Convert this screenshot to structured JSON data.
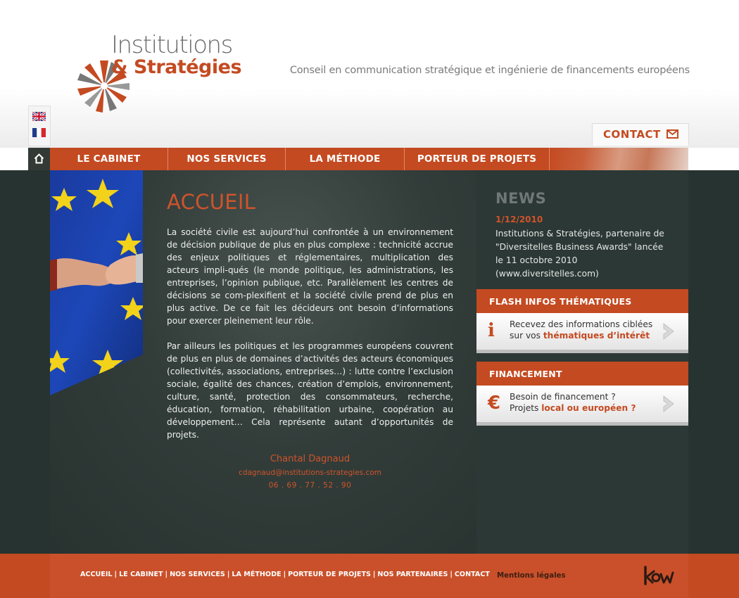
{
  "brand": {
    "line1": "Institutions",
    "line2": "& Stratégies",
    "tagline": "Conseil en communication stratégique et ingénierie de financements européens",
    "accent": "#c44a21",
    "dark": "#263330"
  },
  "languages": [
    "uk-flag-icon",
    "fr-flag-icon"
  ],
  "contact": {
    "label": "CONTACT",
    "icon": "envelope-icon"
  },
  "nav": {
    "home_icon": "home-icon",
    "items": [
      "LE CABINET",
      "NOS SERVICES",
      "LA MÉTHODE",
      "PORTEUR DE PROJETS"
    ]
  },
  "main": {
    "title": "ACCUEIL",
    "paragraphs": [
      "La société civile est aujourd’hui confrontée à un environnement de décision publique de plus en plus complexe : technicité accrue des enjeux politiques et réglementaires, multiplication des acteurs impli-qués (le monde politique, les administrations, les entreprises, l’opinion publique, etc. Parallèlement les centres de décisions se com-plexifient et la société civile prend de plus en plus active. De ce fait les décideurs ont besoin d’informations pour exercer pleinement leur rôle.",
      "Par ailleurs les politiques et les programmes européens couvrent de plus en plus de domaines d’activités des acteurs économiques (collectivités, associations, entreprises…) : lutte contre l’exclusion sociale, égalité des chances, création d’emplois, environnement, culture, santé, protection des consommateurs, recherche, éducation, formation, réhabilitation urbaine, coopération au développement… Cela représente autant d’opportunités de projets."
    ],
    "signature": {
      "name": "Chantal Dagnaud",
      "email": "cdagnaud@institutions-strategies.com",
      "phone": "06 . 69 . 77 . 52 . 90"
    }
  },
  "news": {
    "title": "NEWS",
    "date": "1/12/2010",
    "text": "Institutions & Stratégies, partenaire de \"Diversitelles Business Awards\" lancée le 11 octobre 2010 (www.diversitelles.com)"
  },
  "flash": {
    "title": "FLASH INFOS THÉMATIQUES",
    "icon": "i",
    "line1": "Recevez des informations ciblées",
    "line2_pre": "sur vos ",
    "line2_hl": "thématiques d’intérêt"
  },
  "financement": {
    "title": "FINANCEMENT",
    "icon": "€",
    "line1": "Besoin de financement ?",
    "line2_pre": "Projets ",
    "line2_hl": "local ou européen ?"
  },
  "footer": {
    "links": [
      "ACCUEIL",
      "LE CABINET",
      "NOS SERVICES",
      "LA MÉTHODE",
      "PORTEUR DE PROJETS",
      "NOS PARTENAIRES",
      "CONTACT"
    ],
    "separator": "|",
    "mentions": "Mentions légales",
    "agency_logo": "kw-logo-icon"
  }
}
